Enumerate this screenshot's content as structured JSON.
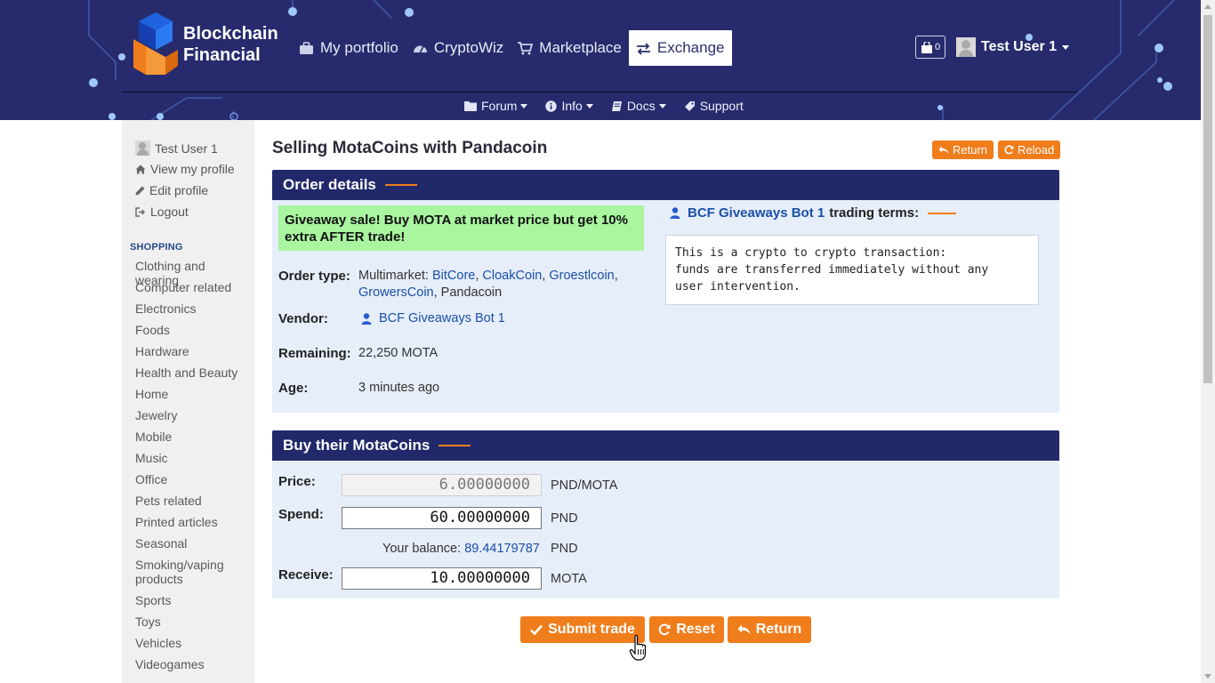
{
  "header": {
    "logo_line1": "Blockchain",
    "logo_line2": "Financial",
    "nav": [
      {
        "label": "My portfolio",
        "icon": "briefcase-icon"
      },
      {
        "label": "CryptoWiz",
        "icon": "tachometer-icon"
      },
      {
        "label": "Marketplace",
        "icon": "cart-icon"
      },
      {
        "label": "Exchange",
        "icon": "exchange-icon",
        "active": true
      }
    ],
    "cart_count": "0",
    "user_name": "Test User 1",
    "subnav": [
      {
        "label": "Forum",
        "icon": "folder-icon"
      },
      {
        "label": "Info",
        "icon": "info-icon"
      },
      {
        "label": "Docs",
        "icon": "book-icon"
      },
      {
        "label": "Support",
        "icon": "tag-icon"
      }
    ]
  },
  "sidebar": {
    "user_name": "Test User 1",
    "links": [
      {
        "label": "View my profile",
        "icon": "home-icon"
      },
      {
        "label": "Edit profile",
        "icon": "pencil-icon"
      },
      {
        "label": "Logout",
        "icon": "sign-out-icon"
      }
    ],
    "shopping_heading": "SHOPPING",
    "categories": [
      "Clothing and wearing",
      "Computer related",
      "Electronics",
      "Foods",
      "Hardware",
      "Health and Beauty",
      "Home",
      "Jewelry",
      "Mobile",
      "Music",
      "Office",
      "Pets related",
      "Printed articles",
      "Seasonal",
      "Smoking/vaping products",
      "Sports",
      "Toys",
      "Vehicles",
      "Videogames"
    ]
  },
  "main": {
    "title": "Selling MotaCoins with Pandacoin",
    "return_label": "Return",
    "reload_label": "Reload",
    "order_details": {
      "heading": "Order details",
      "giveaway_text": "Giveaway sale! Buy MOTA at market price but get 10% extra AFTER trade!",
      "order_type_label": "Order type:",
      "order_type_prefix": "Multimarket:",
      "markets": [
        "BitCore",
        "CloakCoin",
        "Groestlcoin",
        "GrowersCoin"
      ],
      "market_last": "Pandacoin",
      "vendor_label": "Vendor:",
      "vendor_name": "BCF Giveaways Bot 1",
      "remaining_label": "Remaining:",
      "remaining_value": "22,250 MOTA",
      "age_label": "Age:",
      "age_value": "3 minutes ago",
      "terms_vendor": "BCF Giveaways Bot 1",
      "terms_suffix": "trading terms:",
      "terms_text": "This is a crypto to crypto transaction:\nfunds are transferred immediately without any\nuser intervention."
    },
    "buy": {
      "heading": "Buy their MotaCoins",
      "price_label": "Price:",
      "price_value": "6.00000000",
      "price_unit": "PND/MOTA",
      "spend_label": "Spend:",
      "spend_value": "60.00000000",
      "spend_unit": "PND",
      "balance_label": "Your balance:",
      "balance_value": "89.44179787",
      "balance_unit": "PND",
      "receive_label": "Receive:",
      "receive_value": "10.00000000",
      "receive_unit": "MOTA"
    },
    "actions": {
      "submit_label": "Submit trade",
      "reset_label": "Reset",
      "return_label": "Return"
    }
  },
  "colors": {
    "header_bg": "#272b6d",
    "panel_head": "#21296b",
    "accent": "#f07d1c",
    "link": "#1b4fa8",
    "giveaway_bg": "#a9f5a0"
  }
}
